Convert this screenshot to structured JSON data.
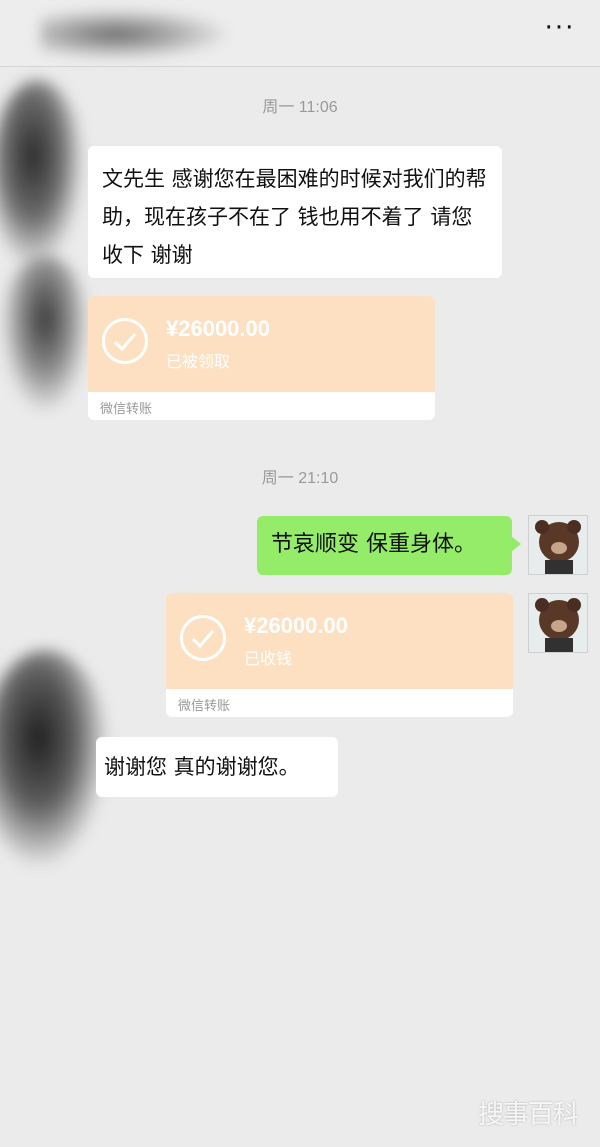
{
  "header": {
    "more_label": "···"
  },
  "messages": {
    "time_1": "周一 11:06",
    "msg_1": "文先生 感谢您在最困难的时候对我们的帮助，现在孩子不在了 钱也用不着了 请您收下 谢谢",
    "transfer_1": {
      "amount": "¥26000.00",
      "status": "已被领取",
      "footer": "微信转账"
    },
    "time_2": "周一 21:10",
    "msg_2": "节哀顺变  保重身体。",
    "transfer_2": {
      "amount": "¥26000.00",
      "status": "已收钱",
      "footer": "微信转账"
    },
    "msg_3": "谢谢您 真的谢谢您。"
  },
  "watermark": "搜事百科",
  "colors": {
    "background": "#ebebeb",
    "green_bubble": "#95ec69",
    "transfer_card": "#fce0c1",
    "timestamp": "#9a9a9a"
  }
}
